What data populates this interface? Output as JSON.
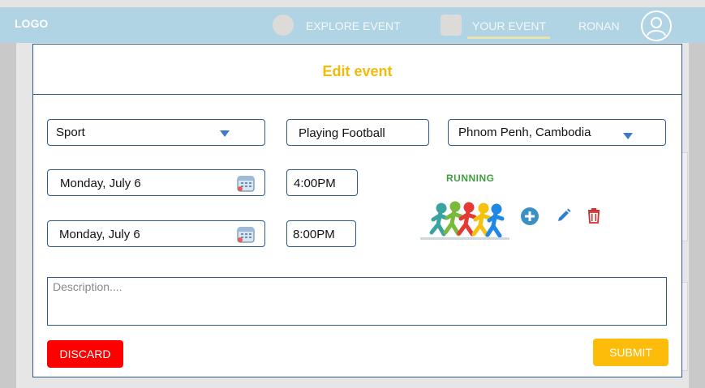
{
  "header": {
    "logo": "LOGO",
    "nav": [
      {
        "label": "EXPLORE EVENT",
        "icon": "people-icon"
      },
      {
        "label": "YOUR EVENT",
        "icon": "calendar-icon",
        "active": true
      }
    ],
    "user": "RONAN",
    "avatar_icon": "user-avatar-icon"
  },
  "modal": {
    "title": "Edit event",
    "category": "Sport",
    "event_name": "Playing Football",
    "location": "Phnom Penh, Cambodia",
    "start_date": "Monday, July 6",
    "start_time": "4:00PM",
    "end_date": "Monday, July 6",
    "end_time": "8:00PM",
    "image_caption": "RUNNING",
    "description_placeholder": "Description....",
    "discard_label": "DISCARD",
    "submit_label": "SUBMIT"
  },
  "colors": {
    "accent": "#f2bb0c",
    "discard": "#ff0000",
    "border": "#2f5b8c",
    "header_bg": "#b0d4e3"
  }
}
